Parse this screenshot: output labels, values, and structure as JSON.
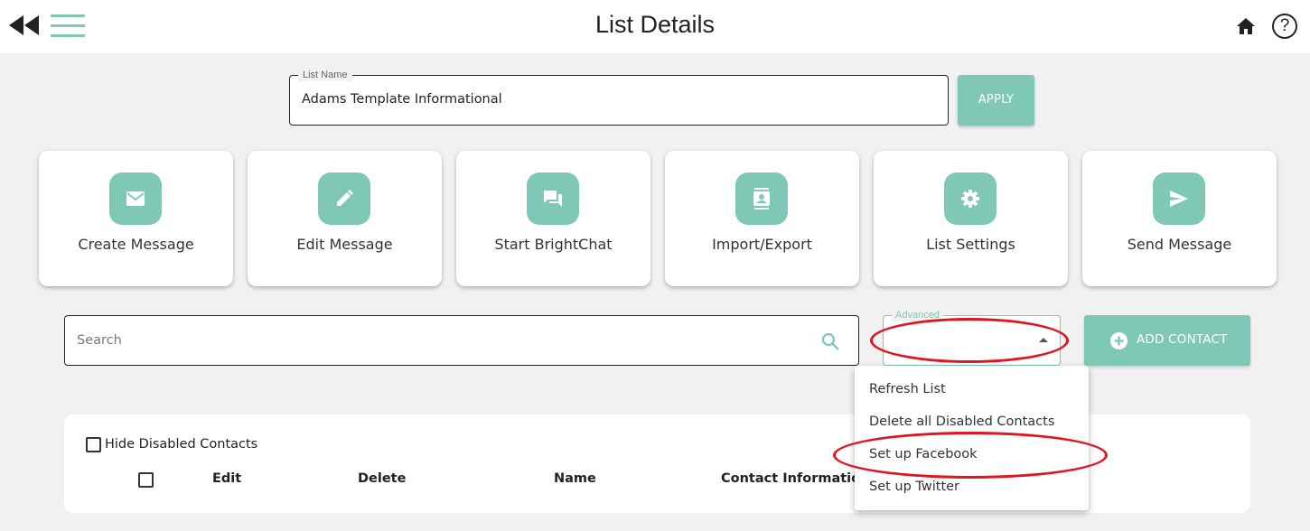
{
  "header": {
    "title": "List Details",
    "back_icon": "double-chevron-left-icon",
    "menu_icon": "hamburger-menu-icon",
    "home_icon": "home-icon",
    "help_icon": "help-icon",
    "help_glyph": "?"
  },
  "list_name": {
    "label": "List Name",
    "value": "Adams Template Informational"
  },
  "apply_button": {
    "label": "APPLY"
  },
  "actions": [
    {
      "label": "Create Message",
      "icon": "envelope-icon"
    },
    {
      "label": "Edit Message",
      "icon": "pencil-icon"
    },
    {
      "label": "Start BrightChat",
      "icon": "chat-icon"
    },
    {
      "label": "Import/Export",
      "icon": "contacts-icon"
    },
    {
      "label": "List Settings",
      "icon": "gear-icon"
    },
    {
      "label": "Send Message",
      "icon": "send-icon"
    }
  ],
  "search": {
    "placeholder": "Search",
    "value": ""
  },
  "advanced": {
    "label": "Advanced",
    "value": ""
  },
  "add_contact": {
    "label": "ADD CONTACT"
  },
  "table": {
    "hide_disabled_label": "Hide Disabled Contacts",
    "columns": [
      "Edit",
      "Delete",
      "Name",
      "Contact Information"
    ]
  },
  "dropdown": {
    "items": [
      "Refresh List",
      "Delete all Disabled Contacts",
      "Set up Facebook",
      "Set up Twitter"
    ]
  },
  "colors": {
    "accent": "#7ec8b5",
    "annotation": "#e0141e",
    "background": "#f1f1f1"
  }
}
